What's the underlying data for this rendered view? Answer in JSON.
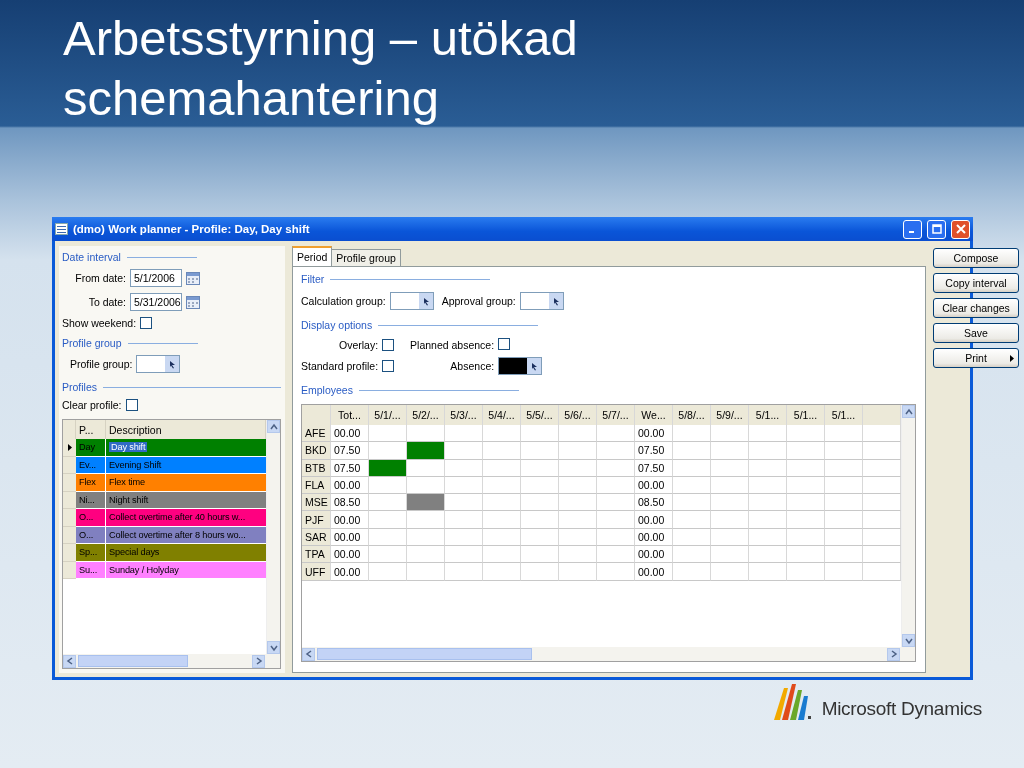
{
  "slide": {
    "title": "Arbetsstyrning – utökad schemahantering"
  },
  "window": {
    "title": "(dmo) Work planner - Profile: Day, Day shift"
  },
  "date_interval": {
    "heading": "Date interval",
    "from": {
      "label": "From date:",
      "value": "5/1/2006"
    },
    "to": {
      "label": "To date:",
      "value": "5/31/2006"
    },
    "show_weekend": {
      "label": "Show weekend:",
      "checked": false
    }
  },
  "profile_group": {
    "heading": "Profile group",
    "field": {
      "label": "Profile group:"
    }
  },
  "profiles": {
    "heading": "Profiles",
    "clear_profile": {
      "label": "Clear profile:",
      "checked": false
    },
    "columns": [
      "P...",
      "Description"
    ],
    "rows": [
      {
        "code": "Day",
        "description": "Day shift",
        "color": "#008000",
        "selected": true
      },
      {
        "code": "Ev...",
        "description": "Evening Shift",
        "color": "#0080ff",
        "selected": false
      },
      {
        "code": "Flex",
        "description": "Flex time",
        "color": "#ff8000",
        "selected": false
      },
      {
        "code": "Ni...",
        "description": "Night shift",
        "color": "#808080",
        "selected": false
      },
      {
        "code": "O...",
        "description": "Collect overtime after 40 hours w...",
        "color": "#ff0080",
        "selected": false
      },
      {
        "code": "O...",
        "description": "Collect overtime after 8 hours wo...",
        "color": "#8080c0",
        "selected": false
      },
      {
        "code": "Sp...",
        "description": "Special days",
        "color": "#808000",
        "selected": false
      },
      {
        "code": "Su...",
        "description": "Sunday / Holyday",
        "color": "#ff80ff",
        "selected": false
      }
    ]
  },
  "tabs": [
    {
      "label": "Period",
      "selected": true
    },
    {
      "label": "Profile group",
      "selected": false
    }
  ],
  "filter": {
    "heading": "Filter",
    "calculation_group": {
      "label": "Calculation group:"
    },
    "approval_group": {
      "label": "Approval group:"
    }
  },
  "display_options": {
    "heading": "Display options",
    "overlay": {
      "label": "Overlay:",
      "checked": false
    },
    "planned_absence": {
      "label": "Planned absence:",
      "checked": false
    },
    "standard_profile": {
      "label": "Standard profile:",
      "checked": false
    },
    "absence": {
      "label": "Absence:",
      "color": "#000000"
    }
  },
  "employees": {
    "heading": "Employees",
    "total_label": "Tot...",
    "days": [
      "5/1/...",
      "5/2/...",
      "5/3/...",
      "5/4/...",
      "5/5/...",
      "5/6/...",
      "5/7/..."
    ],
    "week_label": "We...",
    "days_2": [
      "5/8/...",
      "5/9/...",
      "5/1...",
      "5/1...",
      "5/1..."
    ],
    "rows": [
      {
        "code": "AFE",
        "total": "00.00",
        "days": [
          {
            "kind": "empty"
          },
          {
            "kind": "empty"
          },
          {
            "kind": "empty"
          },
          {
            "kind": "empty"
          },
          {
            "kind": "empty"
          },
          {
            "kind": "empty"
          },
          {
            "kind": "empty"
          }
        ],
        "week": "00.00"
      },
      {
        "code": "BKD",
        "total": "07.50",
        "days": [
          {
            "kind": "empty"
          },
          {
            "kind": "shift",
            "color": "#008000"
          },
          {
            "kind": "empty"
          },
          {
            "kind": "empty"
          },
          {
            "kind": "empty"
          },
          {
            "kind": "empty"
          },
          {
            "kind": "empty"
          }
        ],
        "week": "07.50"
      },
      {
        "code": "BTB",
        "total": "07.50",
        "days": [
          {
            "kind": "shift",
            "color": "#008000"
          },
          {
            "kind": "empty"
          },
          {
            "kind": "empty"
          },
          {
            "kind": "empty"
          },
          {
            "kind": "empty"
          },
          {
            "kind": "empty"
          },
          {
            "kind": "empty"
          }
        ],
        "week": "07.50"
      },
      {
        "code": "FLA",
        "total": "00.00",
        "days": [
          {
            "kind": "empty"
          },
          {
            "kind": "empty"
          },
          {
            "kind": "empty"
          },
          {
            "kind": "empty"
          },
          {
            "kind": "empty"
          },
          {
            "kind": "empty"
          },
          {
            "kind": "empty"
          }
        ],
        "week": "00.00"
      },
      {
        "code": "MSE",
        "total": "08.50",
        "days": [
          {
            "kind": "empty"
          },
          {
            "kind": "shift",
            "color": "#808080"
          },
          {
            "kind": "empty"
          },
          {
            "kind": "empty"
          },
          {
            "kind": "empty"
          },
          {
            "kind": "empty"
          },
          {
            "kind": "empty"
          }
        ],
        "week": "08.50"
      },
      {
        "code": "PJF",
        "total": "00.00",
        "days": [
          {
            "kind": "empty"
          },
          {
            "kind": "empty"
          },
          {
            "kind": "empty"
          },
          {
            "kind": "empty"
          },
          {
            "kind": "empty"
          },
          {
            "kind": "empty"
          },
          {
            "kind": "empty"
          }
        ],
        "week": "00.00"
      },
      {
        "code": "SAR",
        "total": "00.00",
        "days": [
          {
            "kind": "empty"
          },
          {
            "kind": "empty"
          },
          {
            "kind": "empty"
          },
          {
            "kind": "empty"
          },
          {
            "kind": "empty"
          },
          {
            "kind": "empty"
          },
          {
            "kind": "empty"
          }
        ],
        "week": "00.00"
      },
      {
        "code": "TPA",
        "total": "00.00",
        "days": [
          {
            "kind": "empty"
          },
          {
            "kind": "empty"
          },
          {
            "kind": "empty"
          },
          {
            "kind": "empty"
          },
          {
            "kind": "empty"
          },
          {
            "kind": "empty"
          },
          {
            "kind": "empty"
          }
        ],
        "week": "00.00"
      },
      {
        "code": "UFF",
        "total": "00.00",
        "days": [
          {
            "kind": "empty"
          },
          {
            "kind": "empty"
          },
          {
            "kind": "empty"
          },
          {
            "kind": "empty"
          },
          {
            "kind": "empty"
          },
          {
            "kind": "empty"
          },
          {
            "kind": "empty"
          }
        ],
        "week": "00.00"
      }
    ]
  },
  "buttons": [
    {
      "label": "Compose",
      "submenu": false
    },
    {
      "label": "Copy interval",
      "submenu": false
    },
    {
      "label": "Clear changes",
      "submenu": false
    },
    {
      "label": "Save",
      "submenu": false
    },
    {
      "label": "Print",
      "submenu": true
    }
  ],
  "brand": {
    "name": "Microsoft Dynamics"
  }
}
